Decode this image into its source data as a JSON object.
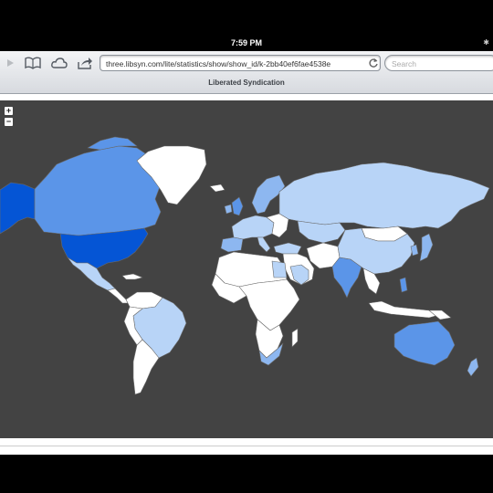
{
  "status": {
    "time": "7:59 PM"
  },
  "toolbar": {
    "url": "three.libsyn.com/lite/statistics/show/show_id/k-2bb40ef6fae4538e",
    "search_placeholder": "Search",
    "back_icon": "play-icon",
    "bookmarks_icon": "book-icon",
    "icloud_icon": "cloud-icon",
    "share_icon": "share-icon",
    "reload_icon": "reload-icon"
  },
  "page": {
    "title": "Liberated Syndication"
  },
  "map": {
    "zoom_in": "+",
    "zoom_out": "−",
    "background_color": "#434343",
    "legend_colors": {
      "highest": "#0555d5",
      "high": "#5b95e8",
      "medium": "#8db7f0",
      "low": "#b8d4f7",
      "none": "#ffffff"
    }
  }
}
